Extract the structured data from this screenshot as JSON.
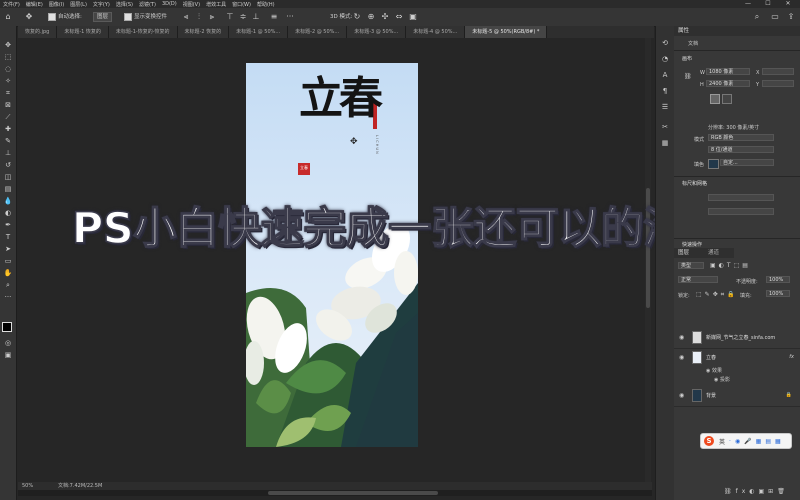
{
  "menu": {
    "items": [
      "文件(F)",
      "编辑(E)",
      "图像(I)",
      "图层(L)",
      "文字(Y)",
      "选择(S)",
      "滤镜(T)",
      "3D(D)",
      "视图(V)",
      "增效工具",
      "窗口(W)",
      "帮助(H)"
    ],
    "minimize": "—",
    "maximize": "☐",
    "close": "✕"
  },
  "options": {
    "auto_select": "自动选择:",
    "layer_select": "图层",
    "show_transform": "显示变换控件",
    "mode_3d": "3D 模式:",
    "more": "···"
  },
  "tabs": [
    {
      "label": "恢复的.jpg"
    },
    {
      "label": "未标题-1 恢复的"
    },
    {
      "label": "未标题-1-恢复的-恢复的"
    },
    {
      "label": "未标题-2 恢复的"
    },
    {
      "label": "未标题-1 @ 50%..."
    },
    {
      "label": "未标题-2 @ 50%..."
    },
    {
      "label": "未标题-3 @ 50%..."
    },
    {
      "label": "未标题-4 @ 50%..."
    },
    {
      "label": "未标题-5 @ 50%(RGB/8#) *"
    }
  ],
  "properties": {
    "tab_properties": "属性",
    "tab_adjust": "调整",
    "doc_label": "文档",
    "canvas_header": "画布",
    "w_label": "W",
    "w_value": "1080 像素",
    "x_label": "X",
    "h_label": "H",
    "h_value": "2400 像素",
    "y_label": "Y",
    "resolution": "分辨率: 300 像素/英寸",
    "mode_label": "模式",
    "mode_value": "RGB 颜色",
    "depth_value": "8 位/通道",
    "fill_label": "填色",
    "fill_value": "自定...",
    "ruler_header": "标尺和网格",
    "quick_header": "快速操作"
  },
  "layers": {
    "tab_layers": "图层",
    "tab_channels": "通道",
    "filter_kind": "类型",
    "blend_mode": "正常",
    "opacity_label": "不透明度:",
    "opacity_value": "100%",
    "lock_label": "锁定:",
    "fill_label": "填充:",
    "fill_value": "100%",
    "rows": [
      {
        "name": "新媒网_节气之立春_sinfa.com"
      },
      {
        "name": "立春"
      },
      {
        "name": "效果"
      },
      {
        "name": "投影"
      },
      {
        "name": "背景"
      }
    ],
    "fx": "fx"
  },
  "poster": {
    "title": "立春",
    "stamp": "立春",
    "vertical_pinyin": "L I   C H U N"
  },
  "status": {
    "zoom": "50%",
    "doc_size": "文档:7.42M/22.5M"
  },
  "overlay": {
    "caption": "PS小白快速完成一张还可以的海报"
  },
  "ime": {
    "logo": "S",
    "lang": "英",
    "icons": [
      "·",
      "◉",
      "🎤",
      "▦",
      "▤",
      "▦"
    ]
  },
  "colors": {
    "bg": "#262626",
    "panel": "#383838",
    "accent_ime": "#ef4a1f",
    "fill_swatch": "#22384a"
  }
}
